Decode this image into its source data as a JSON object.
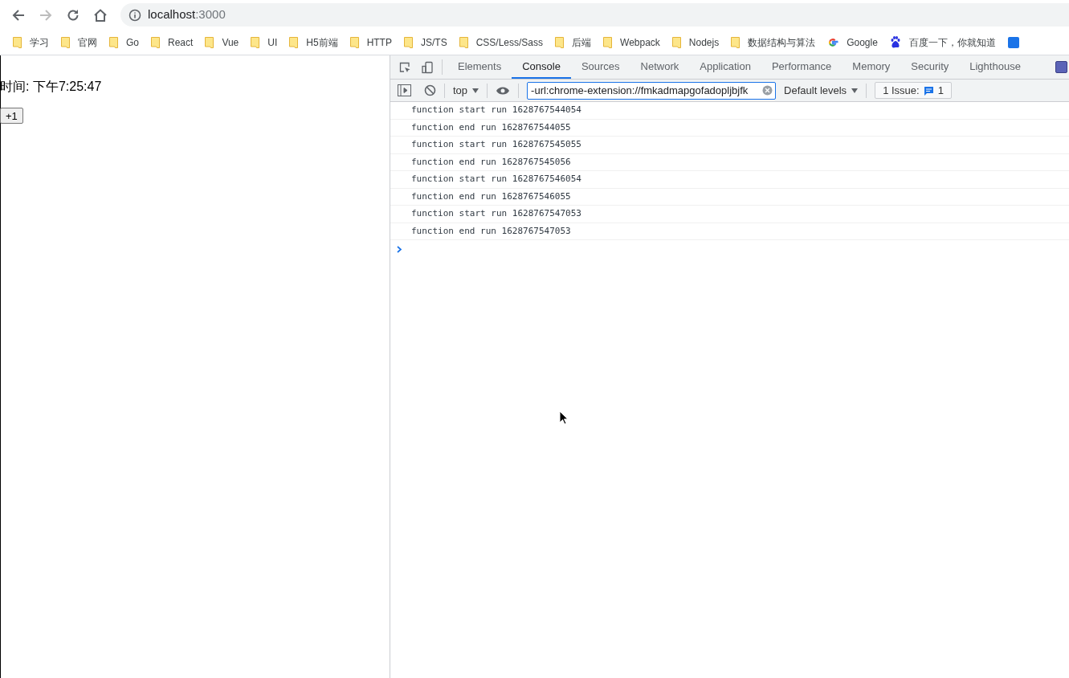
{
  "address_bar": {
    "host": "localhost",
    "port": ":3000"
  },
  "bookmarks": [
    {
      "kind": "folder",
      "label": "学习"
    },
    {
      "kind": "folder",
      "label": "官网"
    },
    {
      "kind": "folder",
      "label": "Go"
    },
    {
      "kind": "folder",
      "label": "React"
    },
    {
      "kind": "folder",
      "label": "Vue"
    },
    {
      "kind": "folder",
      "label": "UI"
    },
    {
      "kind": "folder",
      "label": "H5前端"
    },
    {
      "kind": "folder",
      "label": "HTTP"
    },
    {
      "kind": "folder",
      "label": "JS/TS"
    },
    {
      "kind": "folder",
      "label": "CSS/Less/Sass"
    },
    {
      "kind": "folder",
      "label": "后端"
    },
    {
      "kind": "folder",
      "label": "Webpack"
    },
    {
      "kind": "folder",
      "label": "Nodejs"
    },
    {
      "kind": "folder",
      "label": "数据结构与算法"
    },
    {
      "kind": "google",
      "label": "Google"
    },
    {
      "kind": "baidu",
      "label": "百度一下，你就知道"
    }
  ],
  "page": {
    "time_text": "时间: 下午7:25:47",
    "button": "+1"
  },
  "devtools": {
    "tabs": [
      {
        "label": "Elements",
        "selected": false
      },
      {
        "label": "Console",
        "selected": true
      },
      {
        "label": "Sources",
        "selected": false
      },
      {
        "label": "Network",
        "selected": false
      },
      {
        "label": "Application",
        "selected": false
      },
      {
        "label": "Performance",
        "selected": false
      },
      {
        "label": "Memory",
        "selected": false
      },
      {
        "label": "Security",
        "selected": false
      },
      {
        "label": "Lighthouse",
        "selected": false
      }
    ],
    "context": "top",
    "filter_value": "-url:chrome-extension://fmkadmapgofadopljbjfk",
    "levels": "Default levels",
    "issues_label": "1 Issue:",
    "issues_count": "1",
    "console_lines": [
      "function start run 1628767544054",
      "function end run 1628767544055",
      "function start run 1628767545055",
      "function end run 1628767545056",
      "function start run 1628767546054",
      "function end run 1628767546055",
      "function start run 1628767547053",
      "function end run 1628767547053"
    ]
  }
}
